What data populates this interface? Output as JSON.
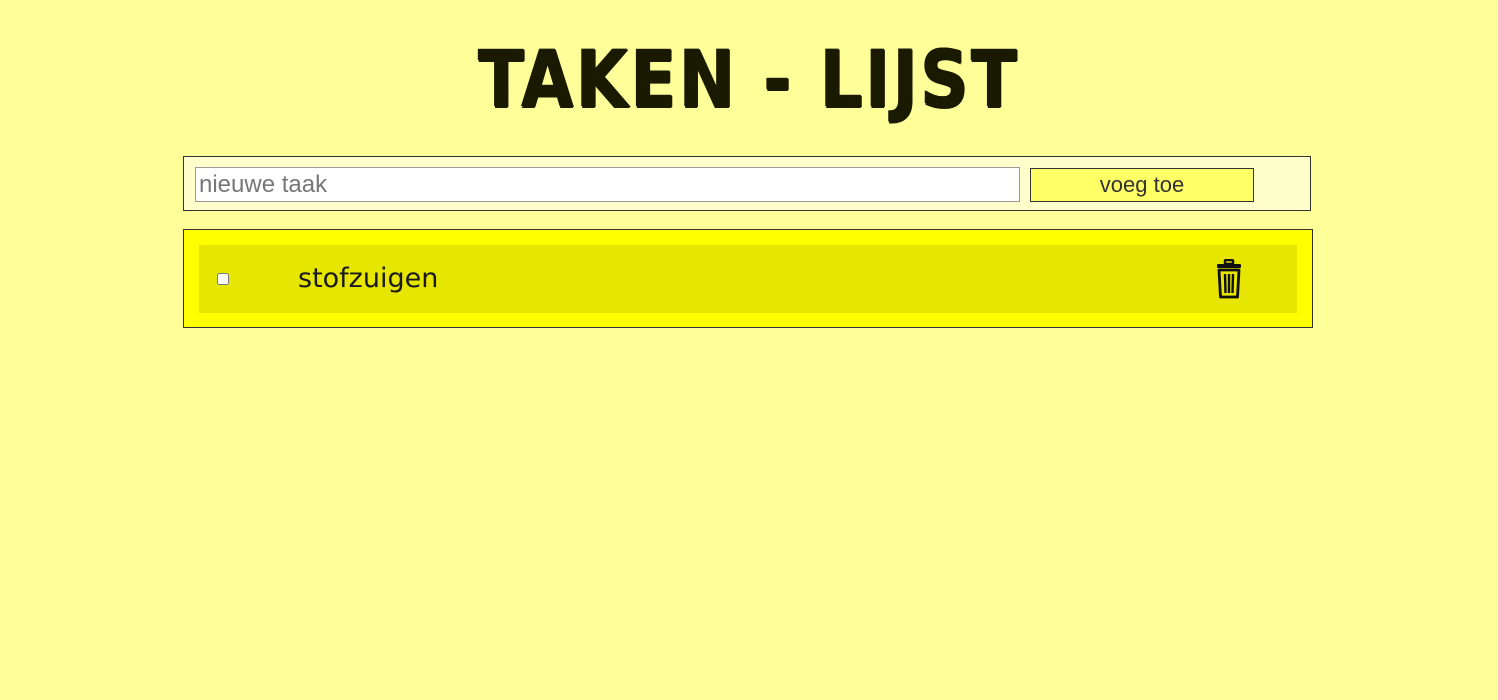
{
  "header": {
    "title": "TAKEN - LIJST"
  },
  "form": {
    "input_placeholder": "nieuwe taak",
    "input_value": "",
    "add_button_label": "voeg toe"
  },
  "tasks": [
    {
      "label": "stofzuigen",
      "done": false,
      "delete_icon": "trash-icon"
    }
  ],
  "colors": {
    "background": "#ffff99",
    "form_background": "#ffffcc",
    "button_background": "#ffff66",
    "list_background": "#ffff00",
    "task_row_background": "#e6e600"
  }
}
